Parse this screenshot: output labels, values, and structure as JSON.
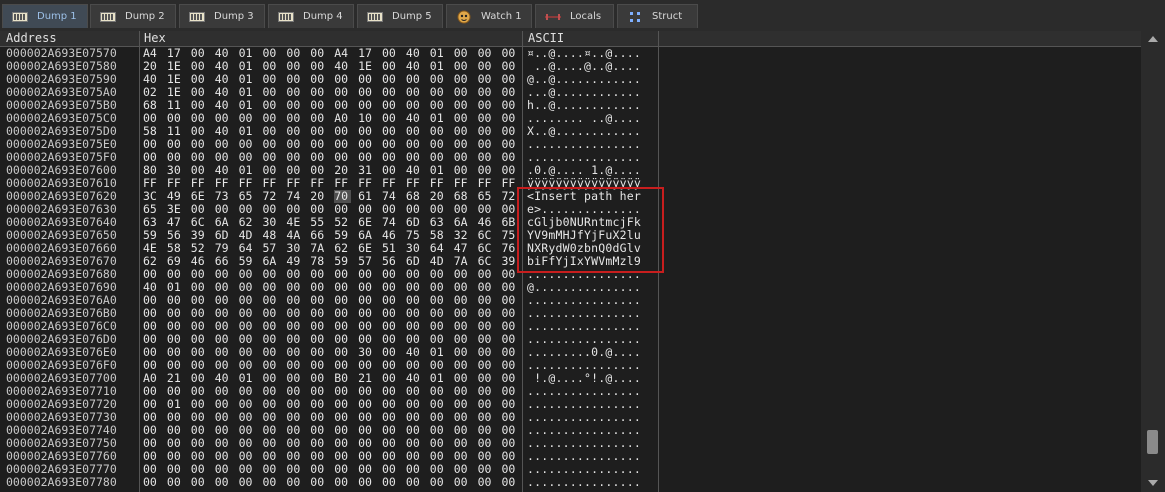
{
  "tabs": [
    {
      "label": "Dump 1",
      "icon": "memory-icon",
      "active": true
    },
    {
      "label": "Dump 2",
      "icon": "memory-icon",
      "active": false
    },
    {
      "label": "Dump 3",
      "icon": "memory-icon",
      "active": false
    },
    {
      "label": "Dump 4",
      "icon": "memory-icon",
      "active": false
    },
    {
      "label": "Dump 5",
      "icon": "memory-icon",
      "active": false
    },
    {
      "label": "Watch 1",
      "icon": "watch-icon",
      "active": false
    },
    {
      "label": "Locals",
      "icon": "locals-icon",
      "active": false
    },
    {
      "label": "Struct",
      "icon": "struct-icon",
      "active": false
    }
  ],
  "columns": {
    "address": "Address",
    "hex": "Hex",
    "ascii": "ASCII"
  },
  "rows": [
    {
      "address": "000002A693E07570",
      "hex": [
        "A4",
        "17",
        "00",
        "40",
        "01",
        "00",
        "00",
        "00",
        "A4",
        "17",
        "00",
        "40",
        "01",
        "00",
        "00",
        "00"
      ],
      "ascii": "¤..@....¤..@...."
    },
    {
      "address": "000002A693E07580",
      "hex": [
        "20",
        "1E",
        "00",
        "40",
        "01",
        "00",
        "00",
        "00",
        "40",
        "1E",
        "00",
        "40",
        "01",
        "00",
        "00",
        "00"
      ],
      "ascii": " ..@....@..@...."
    },
    {
      "address": "000002A693E07590",
      "hex": [
        "40",
        "1E",
        "00",
        "40",
        "01",
        "00",
        "00",
        "00",
        "00",
        "00",
        "00",
        "00",
        "00",
        "00",
        "00",
        "00"
      ],
      "ascii": "@..@............"
    },
    {
      "address": "000002A693E075A0",
      "hex": [
        "02",
        "1E",
        "00",
        "40",
        "01",
        "00",
        "00",
        "00",
        "00",
        "00",
        "00",
        "00",
        "00",
        "00",
        "00",
        "00"
      ],
      "ascii": "...@............"
    },
    {
      "address": "000002A693E075B0",
      "hex": [
        "68",
        "11",
        "00",
        "40",
        "01",
        "00",
        "00",
        "00",
        "00",
        "00",
        "00",
        "00",
        "00",
        "00",
        "00",
        "00"
      ],
      "ascii": "h..@............"
    },
    {
      "address": "000002A693E075C0",
      "hex": [
        "00",
        "00",
        "00",
        "00",
        "00",
        "00",
        "00",
        "00",
        "A0",
        "10",
        "00",
        "40",
        "01",
        "00",
        "00",
        "00"
      ],
      "ascii": "........ ..@...."
    },
    {
      "address": "000002A693E075D0",
      "hex": [
        "58",
        "11",
        "00",
        "40",
        "01",
        "00",
        "00",
        "00",
        "00",
        "00",
        "00",
        "00",
        "00",
        "00",
        "00",
        "00"
      ],
      "ascii": "X..@............"
    },
    {
      "address": "000002A693E075E0",
      "hex": [
        "00",
        "00",
        "00",
        "00",
        "00",
        "00",
        "00",
        "00",
        "00",
        "00",
        "00",
        "00",
        "00",
        "00",
        "00",
        "00"
      ],
      "ascii": "................"
    },
    {
      "address": "000002A693E075F0",
      "hex": [
        "00",
        "00",
        "00",
        "00",
        "00",
        "00",
        "00",
        "00",
        "00",
        "00",
        "00",
        "00",
        "00",
        "00",
        "00",
        "00"
      ],
      "ascii": "................"
    },
    {
      "address": "000002A693E07600",
      "hex": [
        "80",
        "30",
        "00",
        "40",
        "01",
        "00",
        "00",
        "00",
        "20",
        "31",
        "00",
        "40",
        "01",
        "00",
        "00",
        "00"
      ],
      "ascii": ".0.@.... 1.@...."
    },
    {
      "address": "000002A693E07610",
      "hex": [
        "FF",
        "FF",
        "FF",
        "FF",
        "FF",
        "FF",
        "FF",
        "FF",
        "FF",
        "FF",
        "FF",
        "FF",
        "FF",
        "FF",
        "FF",
        "FF"
      ],
      "ascii": "ÿÿÿÿÿÿÿÿÿÿÿÿÿÿÿÿ"
    },
    {
      "address": "000002A693E07620",
      "hex": [
        "3C",
        "49",
        "6E",
        "73",
        "65",
        "72",
        "74",
        "20",
        "70",
        "61",
        "74",
        "68",
        "20",
        "68",
        "65",
        "72"
      ],
      "ascii": "<Insert path her",
      "selected_index": 8
    },
    {
      "address": "000002A693E07630",
      "hex": [
        "65",
        "3E",
        "00",
        "00",
        "00",
        "00",
        "00",
        "00",
        "00",
        "00",
        "00",
        "00",
        "00",
        "00",
        "00",
        "00"
      ],
      "ascii": "e>.............."
    },
    {
      "address": "000002A693E07640",
      "hex": [
        "63",
        "47",
        "6C",
        "6A",
        "62",
        "30",
        "4E",
        "55",
        "52",
        "6E",
        "74",
        "6D",
        "63",
        "6A",
        "46",
        "6B"
      ],
      "ascii": "cGljb0NURntmcjFk"
    },
    {
      "address": "000002A693E07650",
      "hex": [
        "59",
        "56",
        "39",
        "6D",
        "4D",
        "48",
        "4A",
        "66",
        "59",
        "6A",
        "46",
        "75",
        "58",
        "32",
        "6C",
        "75"
      ],
      "ascii": "YV9mMHJfYjFuX2lu"
    },
    {
      "address": "000002A693E07660",
      "hex": [
        "4E",
        "58",
        "52",
        "79",
        "64",
        "57",
        "30",
        "7A",
        "62",
        "6E",
        "51",
        "30",
        "64",
        "47",
        "6C",
        "76"
      ],
      "ascii": "NXRydW0zbnQ0dGlv"
    },
    {
      "address": "000002A693E07670",
      "hex": [
        "62",
        "69",
        "46",
        "66",
        "59",
        "6A",
        "49",
        "78",
        "59",
        "57",
        "56",
        "6D",
        "4D",
        "7A",
        "6C",
        "39"
      ],
      "ascii": "biFfYjIxYWVmMzl9"
    },
    {
      "address": "000002A693E07680",
      "hex": [
        "00",
        "00",
        "00",
        "00",
        "00",
        "00",
        "00",
        "00",
        "00",
        "00",
        "00",
        "00",
        "00",
        "00",
        "00",
        "00"
      ],
      "ascii": "................"
    },
    {
      "address": "000002A693E07690",
      "hex": [
        "40",
        "01",
        "00",
        "00",
        "00",
        "00",
        "00",
        "00",
        "00",
        "00",
        "00",
        "00",
        "00",
        "00",
        "00",
        "00"
      ],
      "ascii": "@..............."
    },
    {
      "address": "000002A693E076A0",
      "hex": [
        "00",
        "00",
        "00",
        "00",
        "00",
        "00",
        "00",
        "00",
        "00",
        "00",
        "00",
        "00",
        "00",
        "00",
        "00",
        "00"
      ],
      "ascii": "................"
    },
    {
      "address": "000002A693E076B0",
      "hex": [
        "00",
        "00",
        "00",
        "00",
        "00",
        "00",
        "00",
        "00",
        "00",
        "00",
        "00",
        "00",
        "00",
        "00",
        "00",
        "00"
      ],
      "ascii": "................"
    },
    {
      "address": "000002A693E076C0",
      "hex": [
        "00",
        "00",
        "00",
        "00",
        "00",
        "00",
        "00",
        "00",
        "00",
        "00",
        "00",
        "00",
        "00",
        "00",
        "00",
        "00"
      ],
      "ascii": "................"
    },
    {
      "address": "000002A693E076D0",
      "hex": [
        "00",
        "00",
        "00",
        "00",
        "00",
        "00",
        "00",
        "00",
        "00",
        "00",
        "00",
        "00",
        "00",
        "00",
        "00",
        "00"
      ],
      "ascii": "................"
    },
    {
      "address": "000002A693E076E0",
      "hex": [
        "00",
        "00",
        "00",
        "00",
        "00",
        "00",
        "00",
        "00",
        "00",
        "30",
        "00",
        "40",
        "01",
        "00",
        "00",
        "00"
      ],
      "ascii": ".........0.@...."
    },
    {
      "address": "000002A693E076F0",
      "hex": [
        "00",
        "00",
        "00",
        "00",
        "00",
        "00",
        "00",
        "00",
        "00",
        "00",
        "00",
        "00",
        "00",
        "00",
        "00",
        "00"
      ],
      "ascii": "................"
    },
    {
      "address": "000002A693E07700",
      "hex": [
        "A0",
        "21",
        "00",
        "40",
        "01",
        "00",
        "00",
        "00",
        "B0",
        "21",
        "00",
        "40",
        "01",
        "00",
        "00",
        "00"
      ],
      "ascii": " !.@....°!.@...."
    },
    {
      "address": "000002A693E07710",
      "hex": [
        "00",
        "00",
        "00",
        "00",
        "00",
        "00",
        "00",
        "00",
        "00",
        "00",
        "00",
        "00",
        "00",
        "00",
        "00",
        "00"
      ],
      "ascii": "................"
    },
    {
      "address": "000002A693E07720",
      "hex": [
        "00",
        "01",
        "00",
        "00",
        "00",
        "00",
        "00",
        "00",
        "00",
        "00",
        "00",
        "00",
        "00",
        "00",
        "00",
        "00"
      ],
      "ascii": "................"
    },
    {
      "address": "000002A693E07730",
      "hex": [
        "00",
        "00",
        "00",
        "00",
        "00",
        "00",
        "00",
        "00",
        "00",
        "00",
        "00",
        "00",
        "00",
        "00",
        "00",
        "00"
      ],
      "ascii": "................"
    },
    {
      "address": "000002A693E07740",
      "hex": [
        "00",
        "00",
        "00",
        "00",
        "00",
        "00",
        "00",
        "00",
        "00",
        "00",
        "00",
        "00",
        "00",
        "00",
        "00",
        "00"
      ],
      "ascii": "................"
    },
    {
      "address": "000002A693E07750",
      "hex": [
        "00",
        "00",
        "00",
        "00",
        "00",
        "00",
        "00",
        "00",
        "00",
        "00",
        "00",
        "00",
        "00",
        "00",
        "00",
        "00"
      ],
      "ascii": "................"
    },
    {
      "address": "000002A693E07760",
      "hex": [
        "00",
        "00",
        "00",
        "00",
        "00",
        "00",
        "00",
        "00",
        "00",
        "00",
        "00",
        "00",
        "00",
        "00",
        "00",
        "00"
      ],
      "ascii": "................"
    },
    {
      "address": "000002A693E07770",
      "hex": [
        "00",
        "00",
        "00",
        "00",
        "00",
        "00",
        "00",
        "00",
        "00",
        "00",
        "00",
        "00",
        "00",
        "00",
        "00",
        "00"
      ],
      "ascii": "................"
    },
    {
      "address": "000002A693E07780",
      "hex": [
        "00",
        "00",
        "00",
        "00",
        "00",
        "00",
        "00",
        "00",
        "00",
        "00",
        "00",
        "00",
        "00",
        "00",
        "00",
        "00"
      ],
      "ascii": "................"
    }
  ]
}
